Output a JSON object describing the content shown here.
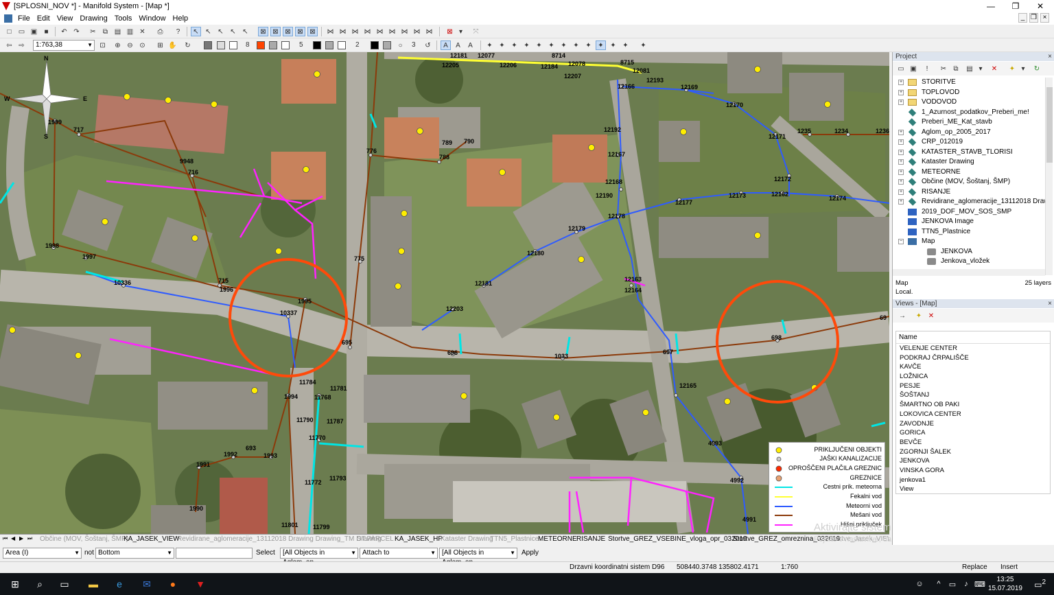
{
  "window": {
    "title": "[SPLOSNI_NOV *] - Manifold System - [Map *]",
    "minimize": "—",
    "restore": "❐",
    "close": "✕"
  },
  "menu": [
    "File",
    "Edit",
    "View",
    "Drawing",
    "Tools",
    "Window",
    "Help"
  ],
  "toolbar2": {
    "scale": "1:763,38",
    "num8": "8",
    "num5": "5",
    "num2": "2",
    "num3": "3"
  },
  "map": {
    "compass": {
      "n": "N",
      "s": "S",
      "e": "E",
      "w": "W"
    },
    "labels": [
      {
        "t": "12181"
      },
      {
        "t": "12077"
      },
      {
        "t": "8714"
      },
      {
        "t": "8715"
      },
      {
        "t": "12205"
      },
      {
        "t": "12206"
      },
      {
        "t": "12184"
      },
      {
        "t": "12078"
      },
      {
        "t": "12207"
      },
      {
        "t": "12081"
      },
      {
        "t": "12193"
      },
      {
        "t": "12166"
      },
      {
        "t": "12169"
      },
      {
        "t": "12170"
      },
      {
        "t": "12192"
      },
      {
        "t": "12167"
      },
      {
        "t": "12171"
      },
      {
        "t": "1235"
      },
      {
        "t": "1234"
      },
      {
        "t": "1236"
      },
      {
        "t": "12168"
      },
      {
        "t": "12172"
      },
      {
        "t": "12190"
      },
      {
        "t": "12177"
      },
      {
        "t": "12173"
      },
      {
        "t": "12162"
      },
      {
        "t": "12174"
      },
      {
        "t": "12178"
      },
      {
        "t": "12179"
      },
      {
        "t": "12180"
      },
      {
        "t": "12181"
      },
      {
        "t": "12163"
      },
      {
        "t": "12164"
      },
      {
        "t": "12203"
      },
      {
        "t": "1999"
      },
      {
        "t": "717"
      },
      {
        "t": "776"
      },
      {
        "t": "789"
      },
      {
        "t": "790"
      },
      {
        "t": "788"
      },
      {
        "t": "9948"
      },
      {
        "t": "716"
      },
      {
        "t": "1998"
      },
      {
        "t": "1997"
      },
      {
        "t": "775"
      },
      {
        "t": "10336"
      },
      {
        "t": "715"
      },
      {
        "t": "1996"
      },
      {
        "t": "1995"
      },
      {
        "t": "10337"
      },
      {
        "t": "695"
      },
      {
        "t": "696"
      },
      {
        "t": "1033"
      },
      {
        "t": "697"
      },
      {
        "t": "698"
      },
      {
        "t": "69"
      },
      {
        "t": "11784"
      },
      {
        "t": "11781"
      },
      {
        "t": "1994"
      },
      {
        "t": "11768"
      },
      {
        "t": "12165"
      },
      {
        "t": "11790"
      },
      {
        "t": "11787"
      },
      {
        "t": "11770"
      },
      {
        "t": "693"
      },
      {
        "t": "1992"
      },
      {
        "t": "1993"
      },
      {
        "t": "1991"
      },
      {
        "t": "11772"
      },
      {
        "t": "11793"
      },
      {
        "t": "4993"
      },
      {
        "t": "4992"
      },
      {
        "t": "1990"
      },
      {
        "t": "11801"
      },
      {
        "t": "11799"
      },
      {
        "t": "4991"
      }
    ],
    "colors": {
      "meteorna": "#00e5e5",
      "fekalni": "#ffff33",
      "meteorni": "#2e5bff",
      "mesani": "#8b3a0a",
      "hisni": "#ff22ff",
      "priklj": "#ffee00",
      "jaski": "#cccccc",
      "oprosceni": "#ff2a00",
      "greznice": "#e8a070",
      "circle": "#ff4a0a"
    }
  },
  "legend": [
    {
      "sym": "dot",
      "color": "#ffee00",
      "label": "PRIKLJUČENI OBJEKTI"
    },
    {
      "sym": "dot",
      "color": "#cccccc",
      "label": "JAŠKI KANALIZACIJE"
    },
    {
      "sym": "dot",
      "color": "#ff2a00",
      "label": "OPROŠČENI PLAČILA GREZNIC"
    },
    {
      "sym": "dot",
      "color": "#e8a070",
      "label": "GREZNICE"
    },
    {
      "sym": "line",
      "color": "#00e5e5",
      "label": "Cestni prik. meteorna"
    },
    {
      "sym": "line",
      "color": "#ffff33",
      "label": "Fekalni vod"
    },
    {
      "sym": "line",
      "color": "#2e5bff",
      "label": "Meteorni vod"
    },
    {
      "sym": "line",
      "color": "#8b3a0a",
      "label": "Mešani vod"
    },
    {
      "sym": "line",
      "color": "#ff22ff",
      "label": "Hišni priključek"
    }
  ],
  "maptabs": [
    {
      "t": "Občine (MOV, Šoštanj, ŠMP)",
      "dim": true
    },
    {
      "t": "KA_JASEK_VIEW",
      "dim": false
    },
    {
      "t": "Revidirane_aglomeracije_13112018 Drawing Drawing_TM Drawing",
      "dim": true
    },
    {
      "t": "ST.PARCEL",
      "dim": true
    },
    {
      "t": "KA_JASEK_HP",
      "dim": false
    },
    {
      "t": "Kataster Drawing",
      "dim": true
    },
    {
      "t": "TTN5_Plastnice",
      "dim": true
    },
    {
      "t": "METEORNE",
      "dim": false
    },
    {
      "t": "RISANJE",
      "dim": false
    },
    {
      "t": "Stortve_GREZ_VSEBINE_vloga_opr_032019",
      "dim": false
    },
    {
      "t": "Stortve_GREZ_omreznina_032019",
      "dim": false
    },
    {
      "t": "Stortve_Jasek_VIEW",
      "dim": true
    }
  ],
  "watermark": {
    "line1": "Aktivirajte sistem Windows",
    "line2": "Pojdite v nastavitve, da aktivirate sistem Windows."
  },
  "selbar": {
    "area": "Area (I)",
    "not": "not",
    "bottom": "Bottom",
    "select": "Select",
    "all1": "[All Objects in Aglom_op_",
    "attach": "Attach to",
    "all2": "[All Objects in Aglom_op_",
    "apply": "Apply"
  },
  "status": {
    "crs": "Drzavni koordinatni sistem D96",
    "coords": "508440.3748 135802.4171",
    "scale": "1:760",
    "replace": "Replace",
    "insert": "Insert"
  },
  "project": {
    "title": "Project",
    "items": [
      {
        "label": "STORITVE",
        "icon": "folder",
        "exp": "+",
        "indent": 0
      },
      {
        "label": "TOPLOVOD",
        "icon": "folder",
        "exp": "+",
        "indent": 0
      },
      {
        "label": "VODOVOD",
        "icon": "folder",
        "exp": "+",
        "indent": 0
      },
      {
        "label": "1_Azurnost_podatkov_Preberi_me!",
        "icon": "drawing",
        "exp": "",
        "indent": 0
      },
      {
        "label": "Preberi_ME_Kat_stavb",
        "icon": "drawing",
        "exp": "",
        "indent": 0
      },
      {
        "label": "Aglom_op_2005_2017",
        "icon": "drawing",
        "exp": "+",
        "indent": 0
      },
      {
        "label": "CRP_012019",
        "icon": "drawing",
        "exp": "+",
        "indent": 0
      },
      {
        "label": "KATASTER_STAVB_TLORISI",
        "icon": "drawing",
        "exp": "+",
        "indent": 0
      },
      {
        "label": "Kataster Drawing",
        "icon": "drawing",
        "exp": "+",
        "indent": 0
      },
      {
        "label": "METEORNE",
        "icon": "drawing",
        "exp": "+",
        "indent": 0
      },
      {
        "label": "Občine (MOV, Šoštanj, ŠMP)",
        "icon": "drawing",
        "exp": "+",
        "indent": 0
      },
      {
        "label": "RISANJE",
        "icon": "drawing",
        "exp": "+",
        "indent": 0
      },
      {
        "label": "Revidirane_aglomeracije_13112018 Drawi",
        "icon": "drawing",
        "exp": "+",
        "indent": 0
      },
      {
        "label": "2019_DOF_MOV_SOS_SMP",
        "icon": "image",
        "exp": "",
        "indent": 0
      },
      {
        "label": "JENKOVA Image",
        "icon": "image",
        "exp": "",
        "indent": 0
      },
      {
        "label": "TTN5_Plastnice",
        "icon": "image",
        "exp": "",
        "indent": 0
      },
      {
        "label": "Map",
        "icon": "map",
        "exp": "−",
        "indent": 0
      },
      {
        "label": "JENKOVA",
        "icon": "comp",
        "exp": "",
        "indent": 1
      },
      {
        "label": "Jenkova_vložek",
        "icon": "comp",
        "exp": "",
        "indent": 1
      }
    ],
    "info_type": "Map",
    "info_layers": "25 layers",
    "info_loc": "Local."
  },
  "views": {
    "title": "Views - [Map]",
    "header": "Name",
    "items": [
      "VELENJE CENTER",
      "PODKRAJ ČRPALIŠČE",
      "KAVČE",
      "LOŽNICA",
      "PESJE",
      "ŠOŠTANJ",
      "ŠMARTNO OB PAKI",
      "LOKOVICA CENTER",
      "ZAVODNJE",
      "GORICA",
      "BEVČE",
      "ZGORNJI ŠALEK",
      "JENKOVA",
      "VINSKA GORA",
      "jenkova1",
      "View"
    ]
  },
  "taskbar": {
    "time": "13:25",
    "date": "15.07.2019",
    "notif": "2"
  }
}
